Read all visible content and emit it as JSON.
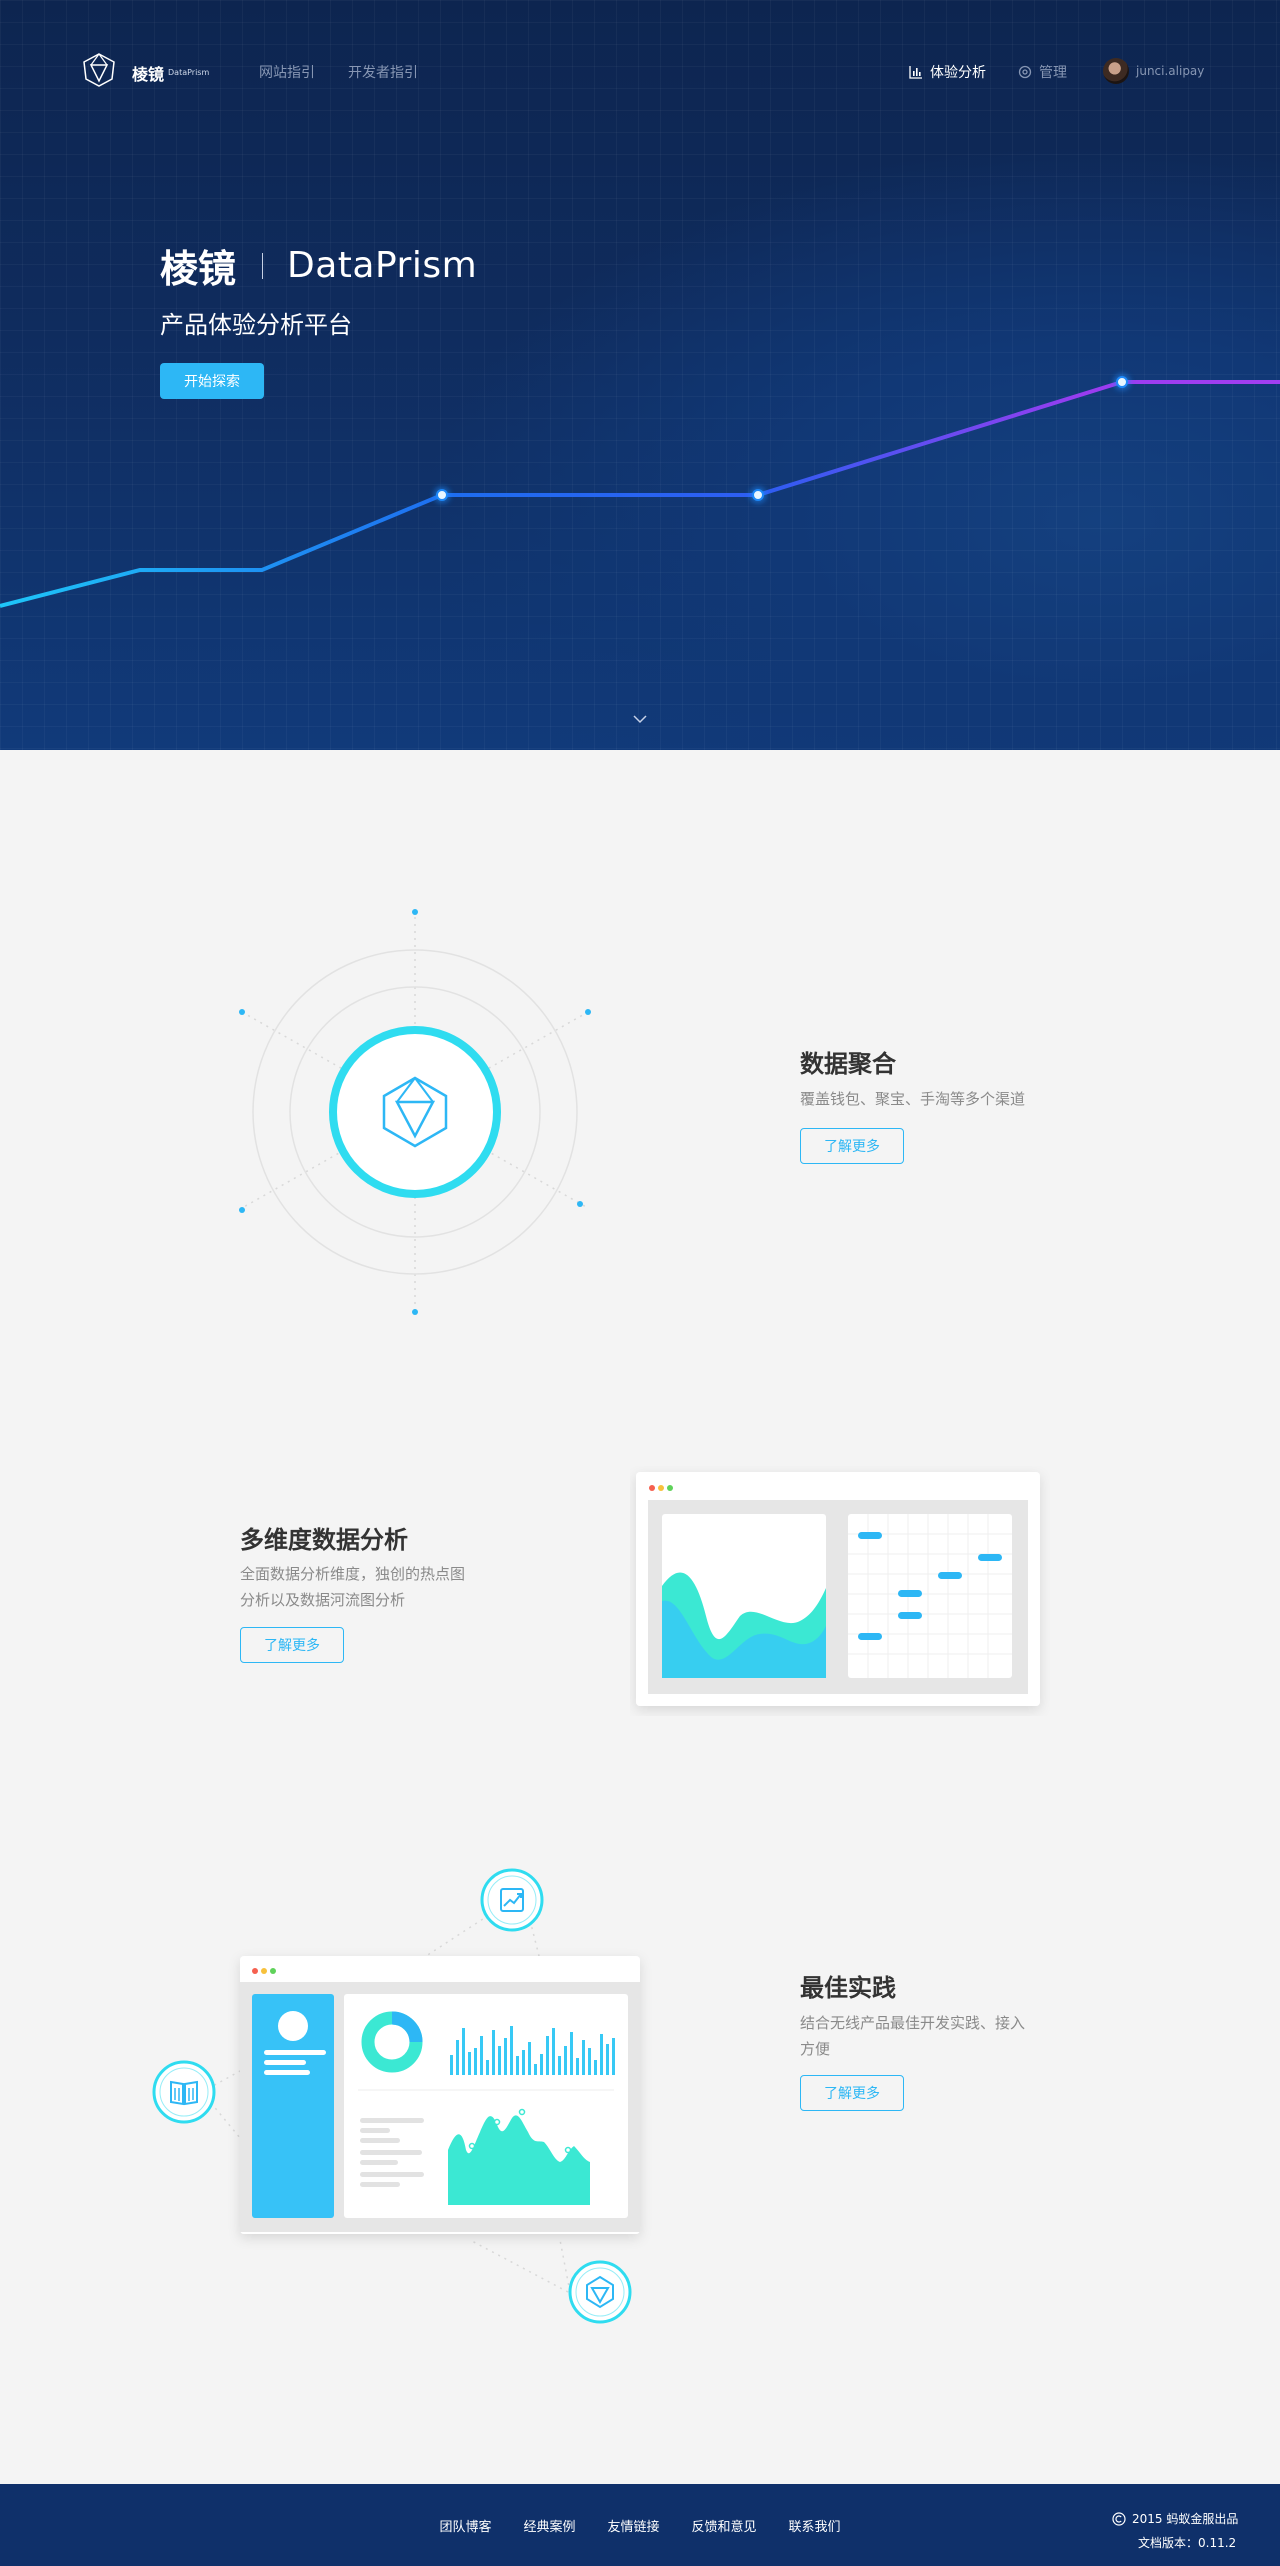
{
  "nav": {
    "logo_name": "棱镜",
    "logo_sub": "DataPrism",
    "links": [
      "网站指引",
      "开发者指引"
    ],
    "analysis_label": "体验分析",
    "manage_label": "管理",
    "user_name": "junci.alipay"
  },
  "hero": {
    "title_cn": "棱镜",
    "title_en": "DataPrism",
    "subtitle": "产品体验分析平台",
    "cta_label": "开始探索"
  },
  "features": [
    {
      "title": "数据聚合",
      "desc_lines": [
        "覆盖钱包、聚宝、手淘等多个渠道"
      ],
      "button": "了解更多"
    },
    {
      "title": "多维度数据分析",
      "desc_lines": [
        "全面数据分析维度，独创的热点图",
        "分析以及数据河流图分析"
      ],
      "button": "了解更多"
    },
    {
      "title": "最佳实践",
      "desc_lines": [
        "结合无线产品最佳开发实践、接入",
        "方便"
      ],
      "button": "了解更多"
    }
  ],
  "footer": {
    "links": [
      "团队博客",
      "经典案例",
      "友情链接",
      "反馈和意见",
      "联系我们"
    ],
    "copyright": "2015 蚂蚁金服出品",
    "doc_version": "文档版本：0.11.2"
  },
  "colors": {
    "accent": "#2db7f5",
    "hero_bg": "#0f2b5c",
    "footer_bg": "#0f306a",
    "teal": "#3be8d3",
    "cyan_ring": "#2fdcf0"
  }
}
